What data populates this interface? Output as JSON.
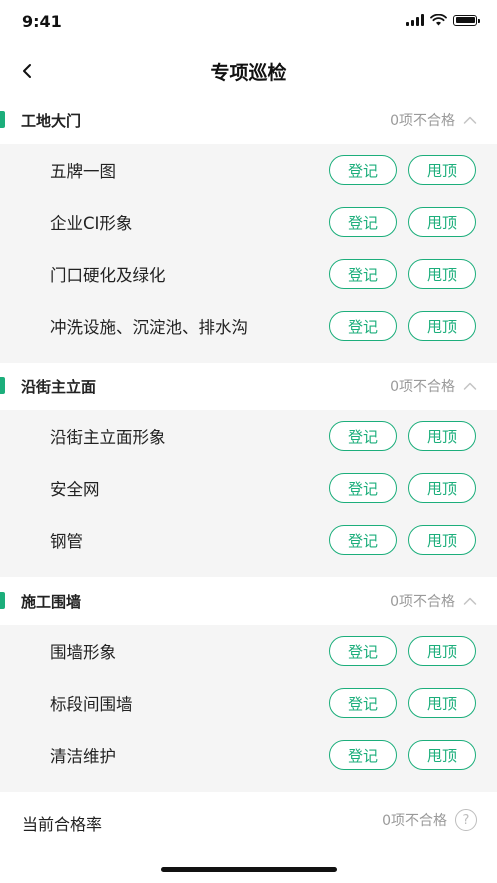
{
  "status_bar": {
    "time": "9:41"
  },
  "nav": {
    "title": "专项巡检"
  },
  "sections": [
    {
      "title": "工地大门",
      "status": "0项不合格",
      "items": [
        {
          "label": "五牌一图"
        },
        {
          "label": "企业CI形象"
        },
        {
          "label": "门口硬化及绿化"
        },
        {
          "label": "冲洗设施、沉淀池、排水沟"
        }
      ]
    },
    {
      "title": "沿街主立面",
      "status": "0项不合格",
      "items": [
        {
          "label": "沿街主立面形象"
        },
        {
          "label": "安全网"
        },
        {
          "label": "钢管"
        }
      ]
    },
    {
      "title": "施工围墙",
      "status": "0项不合格",
      "items": [
        {
          "label": "围墙形象"
        },
        {
          "label": "标段间围墙"
        },
        {
          "label": "清洁维护"
        }
      ]
    }
  ],
  "buttons": {
    "register": "登记",
    "reject": "甩顶"
  },
  "summary": {
    "label": "当前合格率",
    "status": "0项不合格",
    "help": "?"
  },
  "colors": {
    "accent": "#1cae7b",
    "muted": "#9a9a9a",
    "section_bg": "#f5f5f5"
  }
}
